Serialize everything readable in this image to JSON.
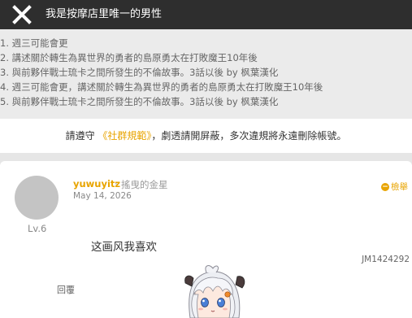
{
  "header": {
    "title": "我是按摩店里唯一的男性",
    "close_icon": "close-icon"
  },
  "info": {
    "lines": [
      "1. 週三可能會更",
      "2. 講述關於轉生為異世界的勇者的島原勇太在打敗魔王10年後",
      "3. 與前夥伴戰士琉卡之間所發生的不倫故事。3話以後 by 枫葉漢化",
      "4. 週三可能會更，講述關於轉生為異世界的勇者的島原勇太在打敗魔王10年後",
      "5. 與前夥伴戰士琉卡之間所發生的不倫故事。3話以後 by 枫葉漢化"
    ]
  },
  "rules": {
    "prefix": "請遵守",
    "link": "《社群規範》",
    "suffix": "，劇透請開屏蔽，多次違規將永遠刪除帳號。"
  },
  "comment": {
    "username": "yuwuyitz",
    "separator": "·",
    "user_title": "搖曳的金星",
    "date": "May 14, 2026",
    "level": "Lv.6",
    "report_label": "檢舉",
    "report_icon_glyph": "−",
    "content": "这画风我喜欢",
    "post_id": "JM1424292",
    "reply_label": "回覆"
  },
  "colors": {
    "accent": "#e8a400",
    "topbar": "#2e2e2e"
  }
}
